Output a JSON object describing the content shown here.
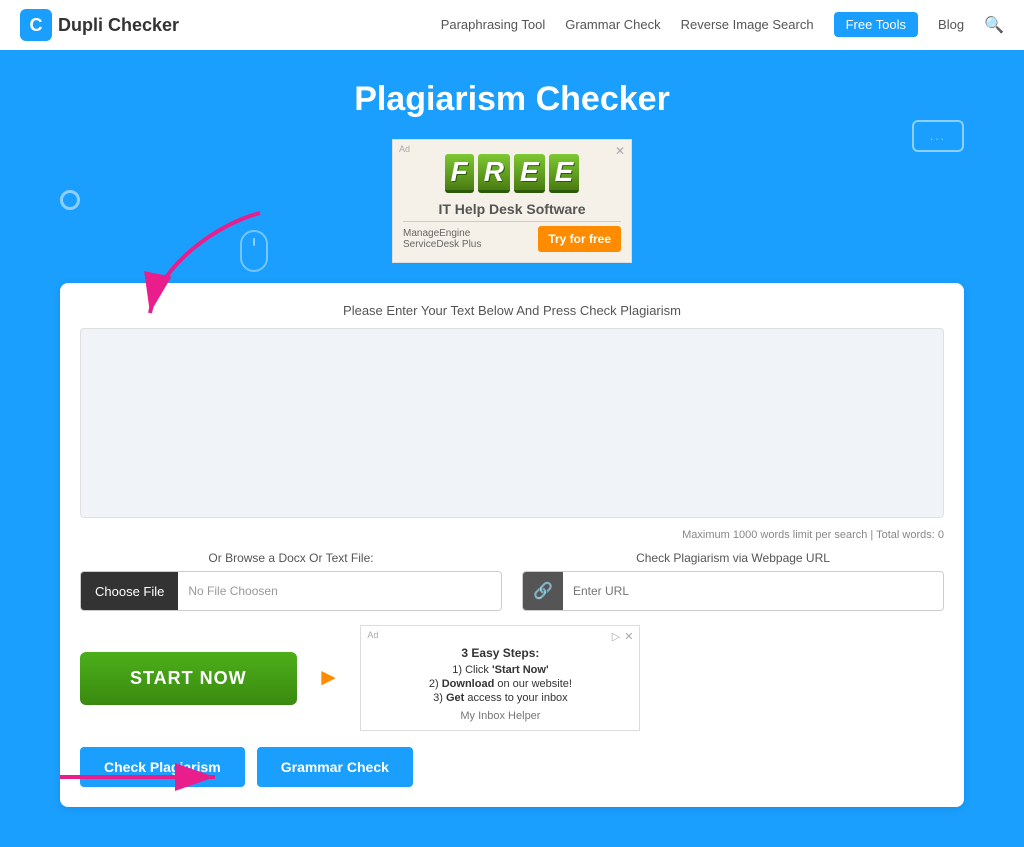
{
  "navbar": {
    "logo_letter": "C",
    "logo_name": "Dupli Checker",
    "links": [
      {
        "label": "Paraphrasing Tool",
        "active": false
      },
      {
        "label": "Grammar Check",
        "active": false
      },
      {
        "label": "Reverse Image Search",
        "active": false
      },
      {
        "label": "Free Tools",
        "active": true
      },
      {
        "label": "Blog",
        "active": false
      }
    ]
  },
  "hero": {
    "title": "Plagiarism Checker"
  },
  "ad": {
    "label": "Ad",
    "free_letters": [
      "F",
      "R",
      "E",
      "E"
    ],
    "subtitle": "IT Help Desk Software",
    "provider_logo": "ManageEngine\nServiceDesk Plus",
    "cta": "Try for free"
  },
  "card": {
    "instruction": "Please Enter Your Text Below And Press Check Plagiarism",
    "textarea_placeholder": "",
    "word_count_info": "Maximum 1000 words limit per search | Total words: 0",
    "upload_label": "Or Browse a Docx Or Text File:",
    "choose_file_label": "Choose File",
    "file_placeholder": "No File Choosen",
    "url_label": "Check Plagiarism via Webpage URL",
    "url_placeholder": "Enter URL",
    "start_now_label": "START NOW",
    "check_plagiarism_label": "Check Plagiarism",
    "grammar_check_label": "Grammar Check"
  },
  "small_ad": {
    "label": "Ad",
    "title": "3 Easy Steps:",
    "steps": [
      "1) Click 'Start Now'",
      "2) Download on our website!",
      "3) Get access to your inbox"
    ],
    "company": "My Inbox Helper"
  }
}
